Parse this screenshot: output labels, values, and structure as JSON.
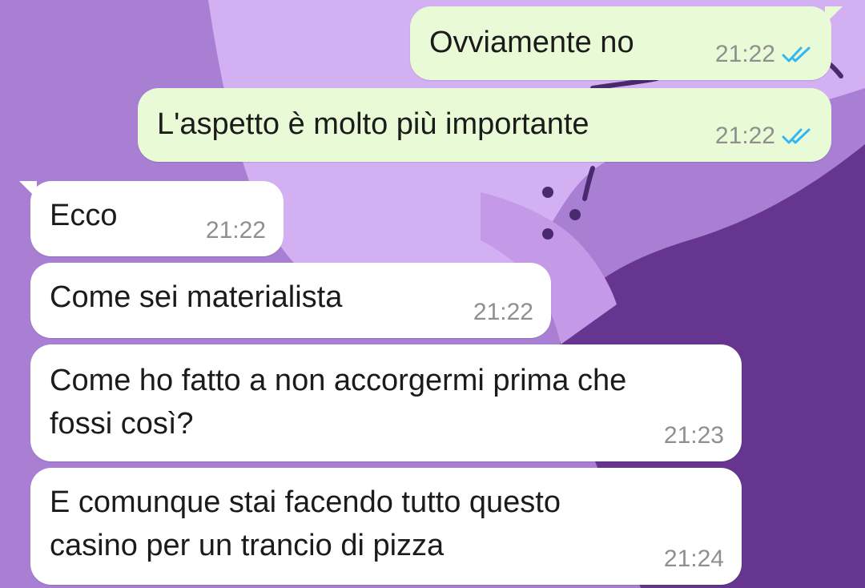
{
  "chat": {
    "messages": [
      {
        "direction": "outgoing",
        "text": "Ovviamente no",
        "time": "21:22",
        "status": "read"
      },
      {
        "direction": "outgoing",
        "text": "L'aspetto è molto più importante",
        "time": "21:22",
        "status": "read"
      },
      {
        "direction": "incoming",
        "text": "Ecco",
        "time": "21:22"
      },
      {
        "direction": "incoming",
        "text": "Come sei materialista",
        "time": "21:22"
      },
      {
        "direction": "incoming",
        "text": "Come ho fatto a non accorgermi prima che\nfossi così?",
        "time": "21:23"
      },
      {
        "direction": "incoming",
        "text": "E comunque stai facendo tutto questo\ncasino per un trancio di pizza",
        "time": "21:24"
      }
    ]
  },
  "icons": {
    "read_receipt": "double-check-icon"
  },
  "colors": {
    "outgoing_bubble": "#e9fbd6",
    "incoming_bubble": "#ffffff",
    "read_tick": "#34b7f1",
    "timestamp": "#8f8f8f",
    "wallpaper_light": "#d2b0f2",
    "wallpaper_mid": "#a87fd2",
    "wallpaper_dark": "#653590"
  }
}
